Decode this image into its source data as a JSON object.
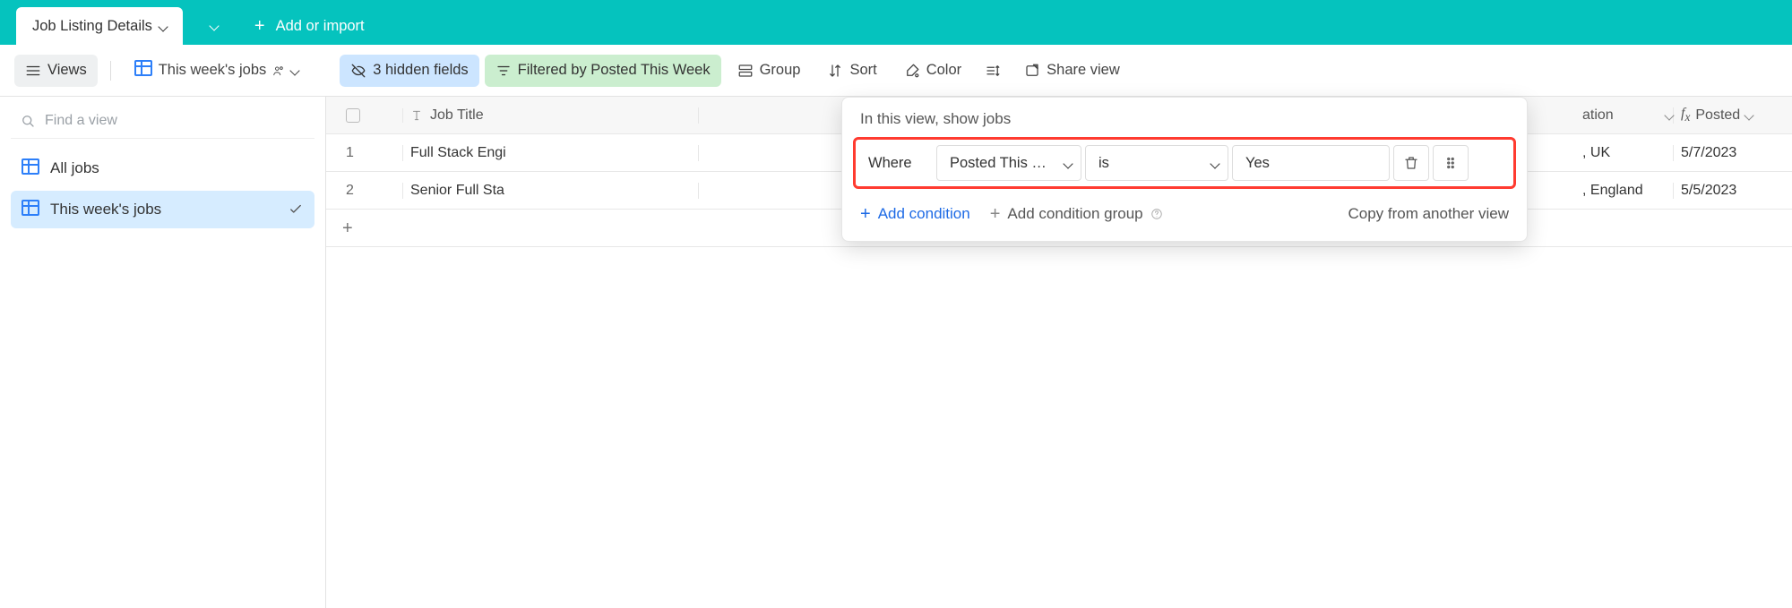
{
  "tabs": {
    "active": "Job Listing Details",
    "add_label": "Add or import"
  },
  "toolbar": {
    "views": "Views",
    "current_view": "This week's jobs",
    "hidden_fields": "3 hidden fields",
    "filter": "Filtered by Posted This Week",
    "group": "Group",
    "sort": "Sort",
    "color": "Color",
    "share": "Share view"
  },
  "sidebar": {
    "search_placeholder": "Find a view",
    "views": [
      {
        "label": "All jobs",
        "selected": false
      },
      {
        "label": "This week's jobs",
        "selected": true
      }
    ]
  },
  "columns": {
    "title": "Job Title",
    "location": "ation",
    "posted": "Posted"
  },
  "rows": [
    {
      "n": "1",
      "title": "Full Stack Engi",
      "loc": ", UK",
      "posted": "5/7/2023"
    },
    {
      "n": "2",
      "title": "Senior Full Sta",
      "loc": ", England",
      "posted": "5/5/2023"
    }
  ],
  "filter_popover": {
    "heading": "In this view, show jobs",
    "conjunction": "Where",
    "field": "Posted This …",
    "operator": "is",
    "value": "Yes",
    "add_condition": "Add condition",
    "add_group": "Add condition group",
    "copy_from": "Copy from another view"
  }
}
